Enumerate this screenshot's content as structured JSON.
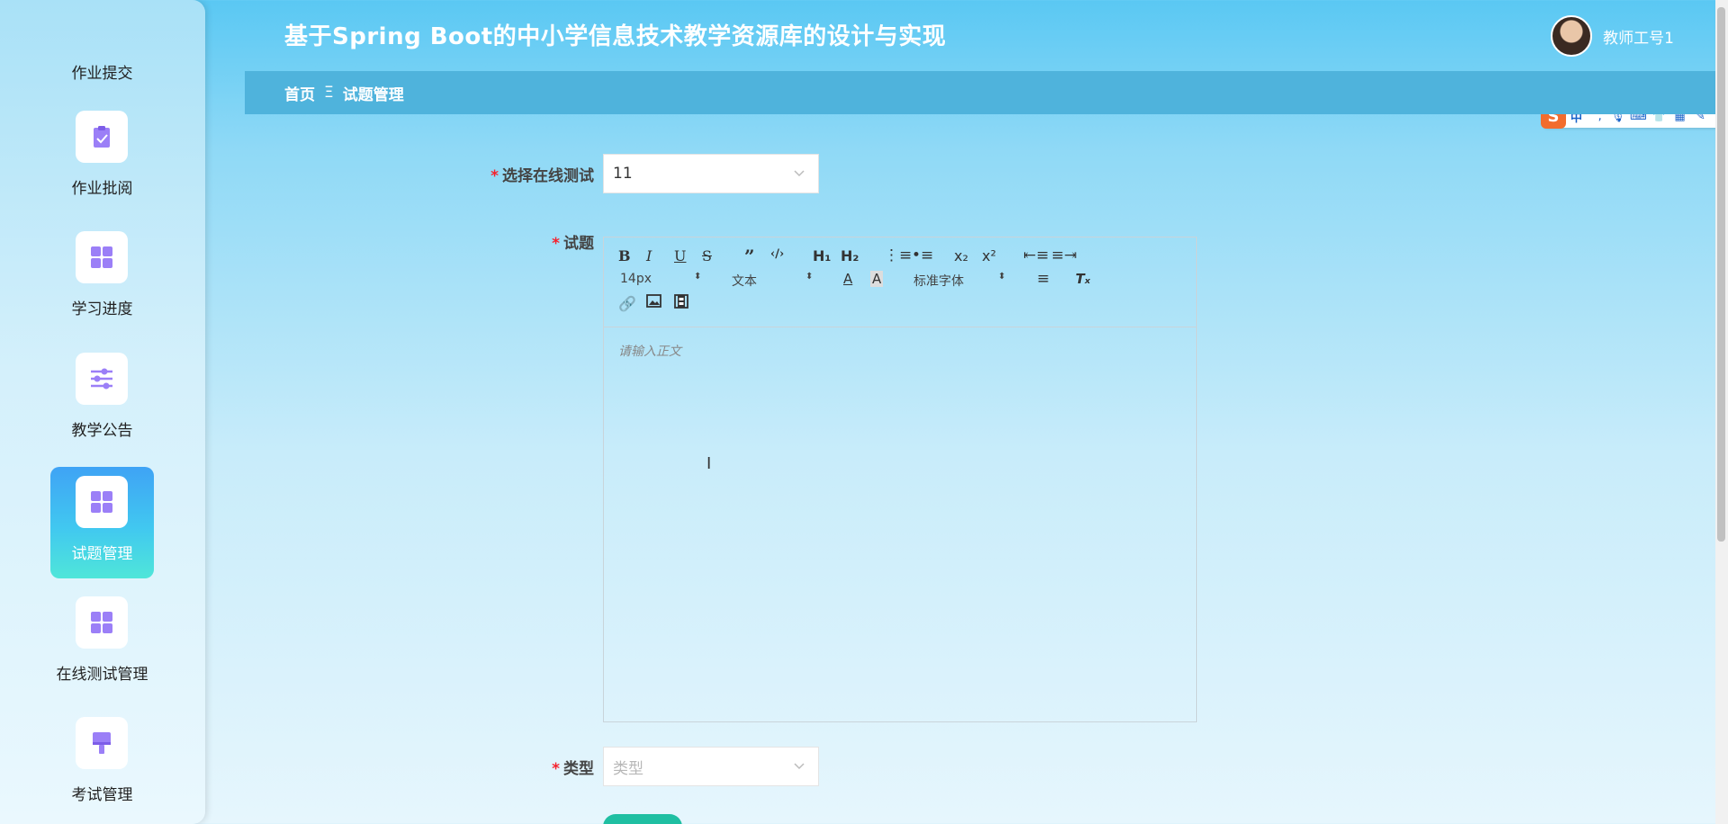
{
  "header": {
    "title": "基于Spring Boot的中小学信息技术教学资源库的设计与实现",
    "user_name": "教师工号1"
  },
  "breadcrumb": {
    "home": "首页",
    "separator": "Ξ",
    "current": "试题管理"
  },
  "sidebar": {
    "items": [
      {
        "label": "作业提交",
        "icon": "none"
      },
      {
        "label": "作业批阅",
        "icon": "clipboard-check-icon"
      },
      {
        "label": "学习进度",
        "icon": "grid-icon"
      },
      {
        "label": "教学公告",
        "icon": "sliders-icon"
      },
      {
        "label": "试题管理",
        "icon": "grid-icon",
        "active": true
      },
      {
        "label": "在线测试管理",
        "icon": "grid-icon"
      },
      {
        "label": "考试管理",
        "icon": "brush-icon"
      }
    ]
  },
  "form": {
    "test_select": {
      "label": "选择在线测试",
      "value": "11"
    },
    "question": {
      "label": "试题",
      "placeholder": "请输入正文"
    },
    "type_select": {
      "label": "类型",
      "placeholder": "类型"
    }
  },
  "editor_toolbar": {
    "font_size": "14px",
    "block_type": "文本",
    "font_family": "标准字体",
    "heading1": "H₁",
    "heading2": "H₂"
  },
  "ime": {
    "mode": "中"
  },
  "colors": {
    "accent": "#9b7ff7",
    "active_gradient_top": "#3fa3f5",
    "active_gradient_bottom": "#4fe6d9",
    "required": "#f5222d"
  }
}
